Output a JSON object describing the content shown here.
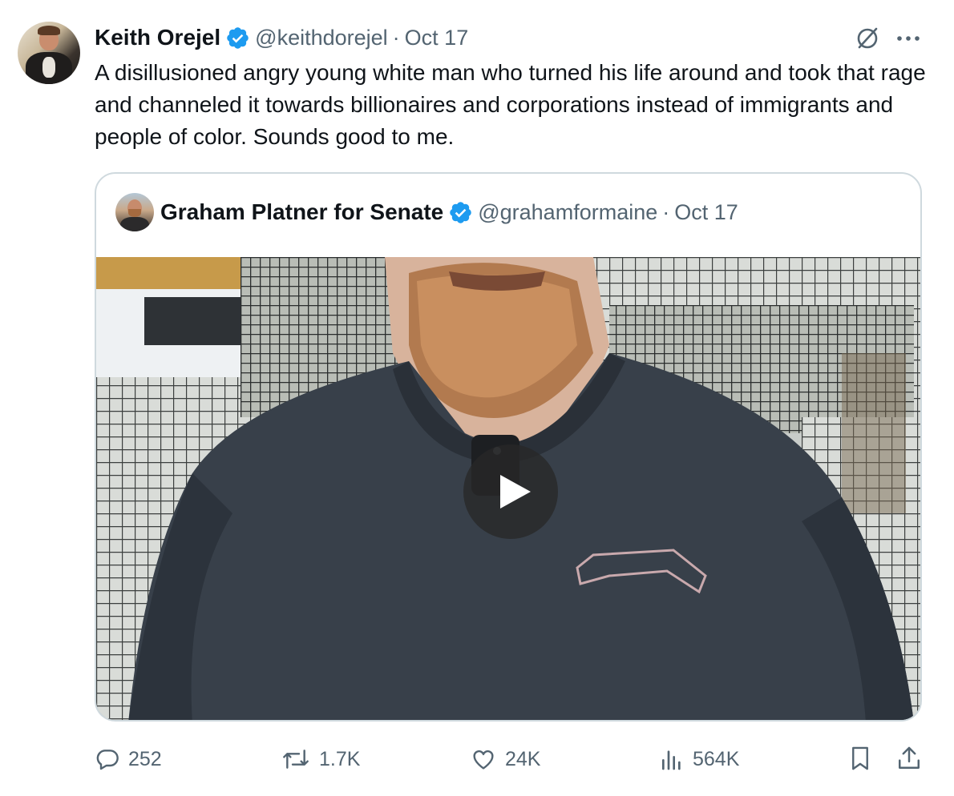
{
  "tweet": {
    "author_name": "Keith Orejel",
    "author_handle": "@keithdorejel",
    "separator": "·",
    "date": "Oct 17",
    "text": "A disillusioned angry young white man who turned his life around and took that rage and channeled it towards billionaires and corporations instead of immigrants and people of color. Sounds good to me."
  },
  "quoted_tweet": {
    "author_name": "Graham Platner for Senate",
    "author_handle": "@grahamformaine",
    "separator": "·",
    "date": "Oct 17",
    "media": "video"
  },
  "actions": {
    "replies": "252",
    "reposts": "1.7K",
    "likes": "24K",
    "views": "564K"
  },
  "colors": {
    "verified": "#1d9bf0",
    "secondary_text": "#536471",
    "border": "#cfd9de"
  },
  "icons": [
    "verified-badge-icon",
    "grok-icon",
    "more-icon",
    "play-icon",
    "reply-icon",
    "repost-icon",
    "like-icon",
    "views-icon",
    "bookmark-icon",
    "share-icon"
  ]
}
